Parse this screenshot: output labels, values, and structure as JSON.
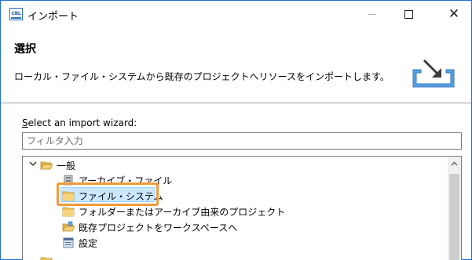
{
  "window": {
    "title": "インポート",
    "app_icon_text": "CBL",
    "minimize_label": "—",
    "maximize_label": "☐",
    "close_label": "✕"
  },
  "header": {
    "title": "選択",
    "description": "ローカル・ファイル・システムから既存のプロジェクトへリソースをインポートします。"
  },
  "wizard": {
    "label_first": "S",
    "label_rest": "elect an import wizard:",
    "filter_placeholder": "フィルタ入力",
    "tree": [
      {
        "label": "一般",
        "icon": "folder-open-icon",
        "expanded": true
      },
      {
        "label": "アーカイブ・ファイル",
        "icon": "archive-icon"
      },
      {
        "label": "ファイル・システム",
        "icon": "folder-icon",
        "selected": true
      },
      {
        "label": "フォルダーまたはアーカイブ由来のプロジェクト",
        "icon": "folder-icon"
      },
      {
        "label": "既存プロジェクトをワークスペースへ",
        "icon": "project-folder-icon"
      },
      {
        "label": "設定",
        "icon": "preferences-icon"
      }
    ]
  },
  "colors": {
    "highlight": "#f29a3a",
    "selection": "#cce8ff",
    "window_border": "#1f6fd1"
  }
}
